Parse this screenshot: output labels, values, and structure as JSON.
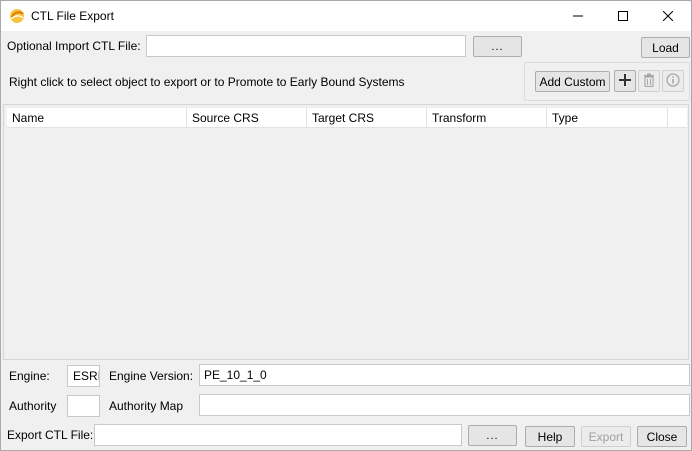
{
  "window": {
    "title": "CTL File Export",
    "icon": "esri-globe-icon"
  },
  "import": {
    "label": "Optional Import CTL File:",
    "value": "",
    "browse_label": "...",
    "load_label": "Load"
  },
  "instruction": "Right click to select object to export or to Promote to Early Bound Systems",
  "toolbar": {
    "add_custom_label": "Add Custom",
    "add_icon": "plus-icon",
    "delete_icon": "trash-icon",
    "info_icon": "info-icon"
  },
  "table": {
    "columns": [
      "Name",
      "Source CRS",
      "Target CRS",
      "Transform",
      "Type"
    ],
    "rows": []
  },
  "engine": {
    "label": "Engine:",
    "value": "ESRI",
    "version_label": "Engine Version:",
    "version_value": "PE_10_1_0"
  },
  "authority": {
    "label": "Authority",
    "value": "",
    "map_label": "Authority Map",
    "map_value": ""
  },
  "export": {
    "label": "Export CTL File:",
    "value": "",
    "browse_label": "...",
    "help_label": "Help",
    "export_label": "Export",
    "close_label": "Close"
  }
}
